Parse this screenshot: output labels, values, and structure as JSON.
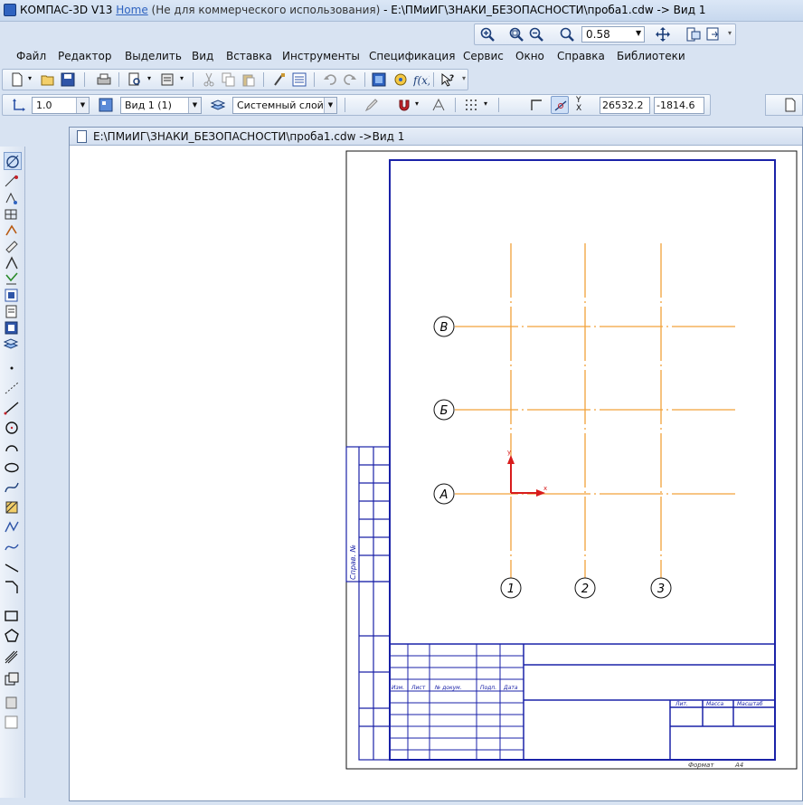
{
  "window": {
    "app": "КОМПАС-3D V13",
    "edition": "Home",
    "note": "(Не для коммерческого использования)",
    "path": "- E:\\ПМиИГ\\ЗНАКИ_БЕЗОПАСНОСТИ\\проба1.cdw -> Вид 1"
  },
  "zoom": {
    "value": "0.58"
  },
  "menu": [
    "Файл",
    "Редактор",
    "Выделить",
    "Вид",
    "Вставка",
    "Инструменты",
    "Спецификация",
    "Сервис",
    "Окно",
    "Справка",
    "Библиотеки"
  ],
  "toolbar": {
    "scale": "1.0",
    "view": "Вид 1 (1)",
    "layer": "Системный слой (",
    "coord_x": "26532.2",
    "coord_y": "-1814.6"
  },
  "document": {
    "title": "E:\\ПМиИГ\\ЗНАКИ_БЕЗОПАСНОСТИ\\проба1.cdw ->Вид 1"
  },
  "drawing": {
    "row_axes": [
      "В",
      "Б",
      "А"
    ],
    "column_axes": [
      "1",
      "2",
      "3"
    ],
    "title_block_header": [
      "Изм.",
      "Лист",
      "№ докум.",
      "Подп.",
      "Дата"
    ],
    "title_block_right_header": [
      "Лит.",
      "Масса",
      "Масштаб"
    ],
    "side_label": "Справ. №",
    "format_label": "Формат",
    "format_value": "A4"
  },
  "colors": {
    "frame": "#1a22a8",
    "axis_line": "#f2a23a",
    "origin_y": "#d81c1c",
    "origin_x": "#d81c1c",
    "titlebar": "#d6e2f3"
  },
  "icons": [
    "app-icon",
    "zoom-icons",
    "pan-icon",
    "new-icon",
    "open-icon",
    "save-icon",
    "print-icon",
    "cut-icon",
    "copy-icon",
    "paste-icon",
    "undo-icon",
    "redo-icon",
    "help-icon",
    "layer-icon",
    "grid-icon",
    "snap-icon"
  ]
}
